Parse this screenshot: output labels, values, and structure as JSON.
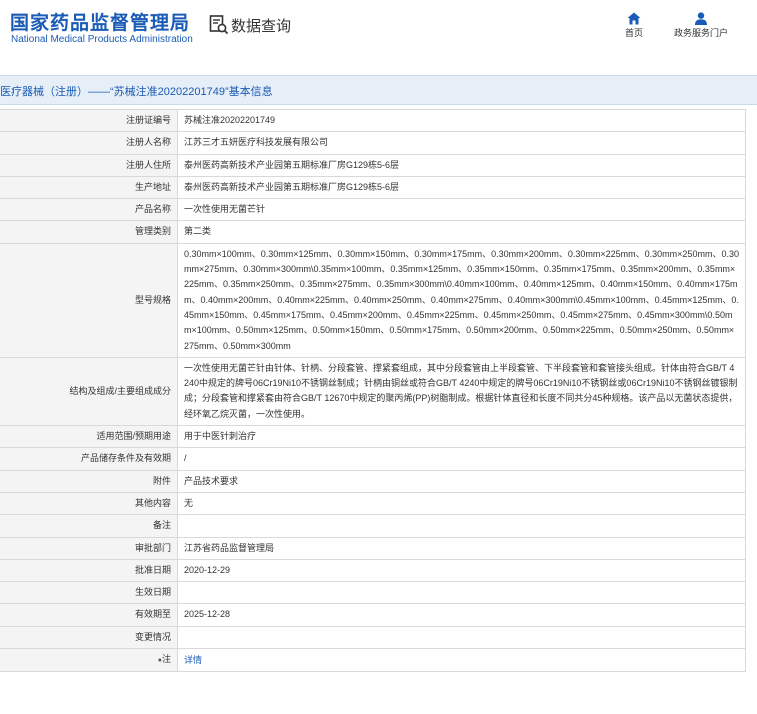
{
  "header": {
    "logo_cn": "国家药品监督管理局",
    "logo_en": "National Medical Products Administration",
    "search_label": "数据查询",
    "nav": [
      {
        "label": "首页",
        "icon": "home-icon"
      },
      {
        "label": "政务服务门户",
        "icon": "user-icon"
      }
    ]
  },
  "title": "医疗器械（注册）——“苏械注准20202201749”基本信息",
  "colors": {
    "brand": "#1a5bb5",
    "titlebar_bg": "#e6eef8",
    "label_bg": "#f4f4f4",
    "border": "#d9d9d9"
  },
  "rows": [
    {
      "label": "注册证编号",
      "value": "苏械注准20202201749"
    },
    {
      "label": "注册人名称",
      "value": "江苏三才五妍医疗科技发展有限公司"
    },
    {
      "label": "注册人住所",
      "value": "泰州医药高新技术产业园第五期标准厂房G129栋5-6层"
    },
    {
      "label": "生产地址",
      "value": "泰州医药高新技术产业园第五期标准厂房G129栋5-6层"
    },
    {
      "label": "产品名称",
      "value": "一次性使用无菌芒针"
    },
    {
      "label": "管理类别",
      "value": "第二类"
    },
    {
      "label": "型号规格",
      "value": "0.30mm×100mm、0.30mm×125mm、0.30mm×150mm、0.30mm×175mm、0.30mm×200mm、0.30mm×225mm、0.30mm×250mm、0.30mm×275mm、0.30mm×300mm\\0.35mm×100mm、0.35mm×125mm、0.35mm×150mm、0.35mm×175mm、0.35mm×200mm、0.35mm×225mm、0.35mm×250mm、0.35mm×275mm、0.35mm×300mm\\0.40mm×100mm、0.40mm×125mm、0.40mm×150mm、0.40mm×175mm、0.40mm×200mm、0.40mm×225mm、0.40mm×250mm、0.40mm×275mm、0.40mm×300mm\\0.45mm×100mm、0.45mm×125mm、0.45mm×150mm、0.45mm×175mm、0.45mm×200mm、0.45mm×225mm、0.45mm×250mm、0.45mm×275mm、0.45mm×300mm\\0.50mm×100mm、0.50mm×125mm、0.50mm×150mm、0.50mm×175mm、0.50mm×200mm、0.50mm×225mm、0.50mm×250mm、0.50mm×275mm、0.50mm×300mm"
    },
    {
      "label": "结构及组成/主要组成成分",
      "value": "一次性使用无菌芒针由针体、针柄、分段套管、撑紧套组成，其中分段套管由上半段套管、下半段套管和套管接头组成。针体由符合GB/T 4240中规定的牌号06Cr19Ni10不锈钢丝制成；针柄由铜丝或符合GB/T 4240中规定的牌号06Cr19Ni10不锈钢丝或06Cr19Ni10不锈钢丝镀银制成；分段套管和撑紧套由符合GB/T 12670中规定的聚丙烯(PP)树脂制成。根据针体直径和长度不同共分45种规格。该产品以无菌状态提供，经环氧乙烷灭菌，一次性使用。"
    },
    {
      "label": "适用范围/预期用途",
      "value": "用于中医针刺治疗"
    },
    {
      "label": "产品储存条件及有效期",
      "value": "/"
    },
    {
      "label": "附件",
      "value": "产品技术要求"
    },
    {
      "label": "其他内容",
      "value": "无"
    },
    {
      "label": "备注",
      "value": ""
    },
    {
      "label": "审批部门",
      "value": "江苏省药品监督管理局"
    },
    {
      "label": "批准日期",
      "value": "2020-12-29"
    },
    {
      "label": "生效日期",
      "value": ""
    },
    {
      "label": "有效期至",
      "value": "2025-12-28"
    },
    {
      "label": "变更情况",
      "value": ""
    }
  ],
  "note_row": {
    "label": "注",
    "value": "详情",
    "icon": "note-icon"
  }
}
